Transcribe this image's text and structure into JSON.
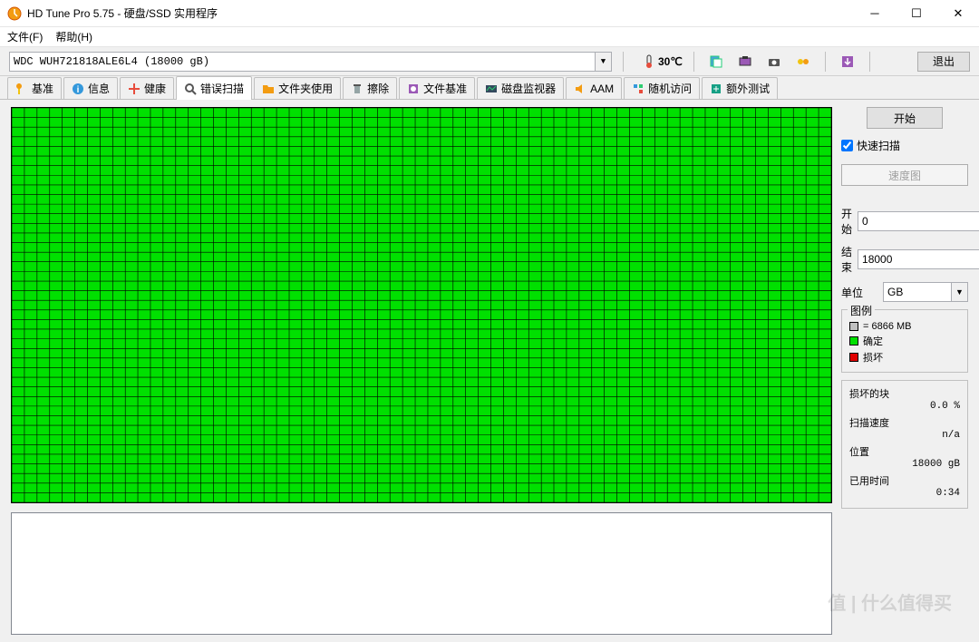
{
  "window": {
    "title": "HD Tune Pro 5.75 - 硬盘/SSD 实用程序"
  },
  "menu": {
    "file": "文件(F)",
    "help": "帮助(H)"
  },
  "drive": {
    "name": "WDC  WUH721818ALE6L4 (18000 gB)"
  },
  "temperature": "30℃",
  "exit_button": "退出",
  "tabs": {
    "benchmark": "基准",
    "info": "信息",
    "health": "健康",
    "error_scan": "错误扫描",
    "folder_usage": "文件夹使用",
    "erase": "擦除",
    "file_benchmark": "文件基准",
    "disk_monitor": "磁盘监视器",
    "aam": "AAM",
    "random_access": "随机访问",
    "extra_tests": "额外测试"
  },
  "scan": {
    "start_button": "开始",
    "quick_scan_label": "快速扫描",
    "speed_map_button": "速度图",
    "start_label": "开始",
    "start_value": "0",
    "end_label": "结束",
    "end_value": "18000",
    "unit_label": "单位",
    "unit_value": "GB"
  },
  "legend": {
    "title": "图例",
    "block_size": "= 6866 MB",
    "ok": "确定",
    "damaged": "损坏"
  },
  "stats": {
    "damaged_blocks_label": "损坏的块",
    "damaged_blocks_value": "0.0 %",
    "scan_speed_label": "扫描速度",
    "scan_speed_value": "n/a",
    "position_label": "位置",
    "position_value": "18000 gB",
    "elapsed_label": "已用时间",
    "elapsed_value": "0:34"
  },
  "watermark": "值 | 什么值得买"
}
